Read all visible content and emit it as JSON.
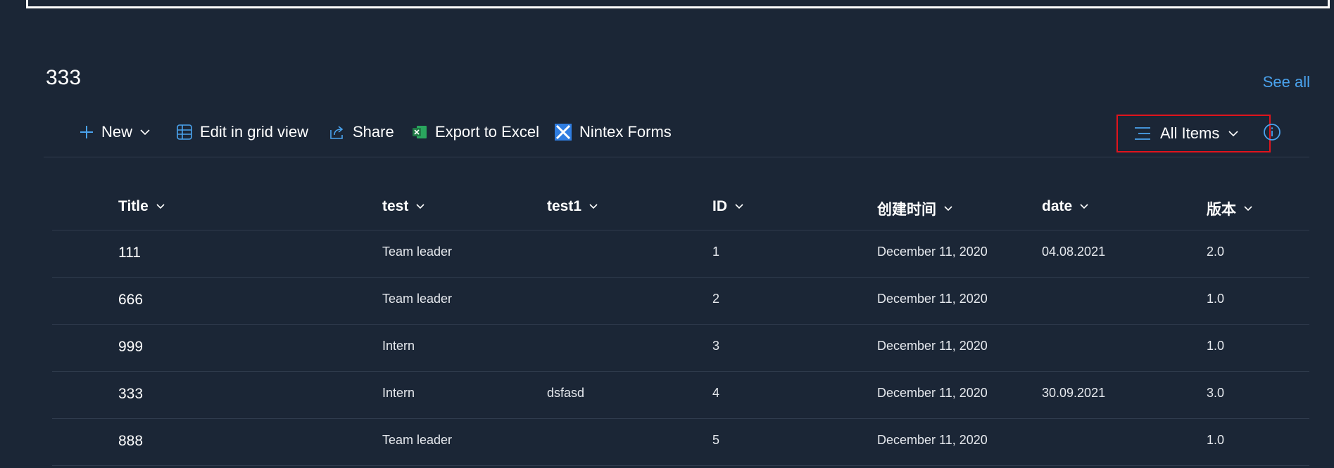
{
  "section": {
    "title": "333",
    "see_all": "See all"
  },
  "toolbar": {
    "new_label": "New",
    "edit_grid_label": "Edit in grid view",
    "share_label": "Share",
    "export_label": "Export to Excel",
    "nintex_label": "Nintex Forms"
  },
  "view": {
    "label": "All Items"
  },
  "icons": {
    "accent": "#4aa3ee",
    "excel_green": "#1f7a45",
    "nintex_blue": "#2f7de1",
    "highlight_red": "#e0141c"
  },
  "table": {
    "columns": [
      {
        "key": "title",
        "label": "Title"
      },
      {
        "key": "test",
        "label": "test"
      },
      {
        "key": "test1",
        "label": "test1"
      },
      {
        "key": "id",
        "label": "ID"
      },
      {
        "key": "created",
        "label": "创建时间"
      },
      {
        "key": "date",
        "label": "date"
      },
      {
        "key": "version",
        "label": "版本"
      }
    ],
    "rows": [
      {
        "title": "111",
        "test": "Team leader",
        "test1": "",
        "id": "1",
        "created": "December 11, 2020",
        "date": "04.08.2021",
        "version": "2.0"
      },
      {
        "title": "666",
        "test": "Team leader",
        "test1": "",
        "id": "2",
        "created": "December 11, 2020",
        "date": "",
        "version": "1.0"
      },
      {
        "title": "999",
        "test": "Intern",
        "test1": "",
        "id": "3",
        "created": "December 11, 2020",
        "date": "",
        "version": "1.0"
      },
      {
        "title": "333",
        "test": "Intern",
        "test1": "dsfasd",
        "id": "4",
        "created": "December 11, 2020",
        "date": "30.09.2021",
        "version": "3.0"
      },
      {
        "title": "888",
        "test": "Team leader",
        "test1": "",
        "id": "5",
        "created": "December 11, 2020",
        "date": "",
        "version": "1.0"
      }
    ]
  }
}
